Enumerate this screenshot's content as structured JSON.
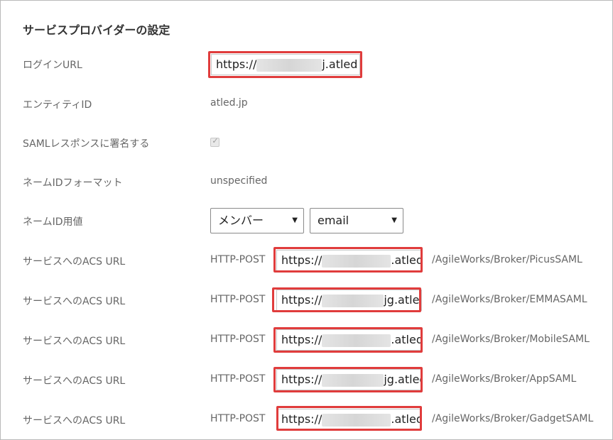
{
  "section_title": "サービスプロバイダーの設定",
  "login_url": {
    "label": "ログインURL",
    "prefix": "https://",
    "suffix": "j.atled"
  },
  "entity_id": {
    "label": "エンティティID",
    "value": "atled.jp"
  },
  "saml_sign": {
    "label": "SAMLレスポンスに署名する",
    "checked": true
  },
  "nameid_format": {
    "label": "ネームIDフォーマット",
    "value": "unspecified"
  },
  "nameid_value": {
    "label": "ネームID用値",
    "select1": "メンバー",
    "select2": "email"
  },
  "acs": [
    {
      "label": "サービスへのACS URL",
      "method": "HTTP-POST",
      "prefix": "https://",
      "suffix": ".atled",
      "path": "/AgileWorks/Broker/PicusSAML"
    },
    {
      "label": "サービスへのACS URL",
      "method": "HTTP-POST",
      "prefix": "https://",
      "suffix": "jg.atled",
      "path": "/AgileWorks/Broker/EMMASAML"
    },
    {
      "label": "サービスへのACS URL",
      "method": "HTTP-POST",
      "prefix": "https://",
      "suffix": ".atled",
      "path": "/AgileWorks/Broker/MobileSAML"
    },
    {
      "label": "サービスへのACS URL",
      "method": "HTTP-POST",
      "prefix": "https://",
      "suffix": "jg.atled",
      "path": "/AgileWorks/Broker/AppSAML"
    },
    {
      "label": "サービスへのACS URL",
      "method": "HTTP-POST",
      "prefix": "https://",
      "suffix": ".atled",
      "path": "/AgileWorks/Broker/GadgetSAML"
    }
  ],
  "colors": {
    "highlight": "#e03c3c",
    "label": "#666666",
    "title": "#333333"
  }
}
